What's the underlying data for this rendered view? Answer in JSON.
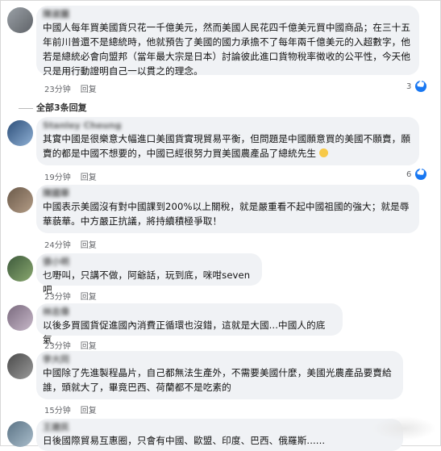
{
  "comments": [
    {
      "name": "陳淑麗",
      "text": "中國人每年買美國貨只花一千億美元，然而美國人民花四千億美元買中國商品；在三十五年前川普還不是總統時，他就預告了美國的國力承擔不了每年兩千億美元的入超數字，他若是總統必會向盟邦（當年最大宗是日本）討論彼此進口貨物稅率徵收的公平性，今天他只是用行動證明自己一以貫之的理念。",
      "time": "23分钟",
      "reply": "回复",
      "likes": "3"
    },
    {
      "name": "Stanley Cheung",
      "text": "其實中國是很樂意大幅進口美國貨實現貿易平衡，但問題是中國願意買的美國不願賣，願賣的都是中國不想要的，中國已經很努力買美國農產品了總統先生",
      "time": "19分钟",
      "reply": "回复",
      "likes": "6"
    },
    {
      "name": "陳國華",
      "text": "中國表示美國沒有對中國課到200%以上關稅，就是嚴重看不起中國祖國的強大；就是辱華藐華。中方嚴正抗議，將持續積極爭取！",
      "time": "24分钟",
      "reply": "回复",
      "likes": ""
    },
    {
      "name": "張小明",
      "text": "乜嘢叫，只講不做，阿爺話，玩到底，咪咁seven吧",
      "time": "23分钟",
      "reply": "回复",
      "likes": ""
    },
    {
      "name": "林志偉",
      "text": "以後多買國貨促進國內消費正循環也沒錯，這就是大國...中國人的底氣",
      "time": "23分钟",
      "reply": "回复",
      "likes": ""
    },
    {
      "name": "李大同",
      "text": "中國除了先進製程晶片，自己都無法生產外，不需要美國什麼，美國光農產品要賣給誰，頭就大了，畢竟巴西、荷蘭都不是吃素的",
      "time": "15分钟",
      "reply": "回复",
      "likes": ""
    },
    {
      "name": "王建民",
      "text": "日後國際貿易互惠圈，只會有中國、歐盟、印度、巴西、俄羅斯......",
      "time": "",
      "reply": "",
      "likes": ""
    }
  ],
  "view_all_replies": "全部3条回复"
}
